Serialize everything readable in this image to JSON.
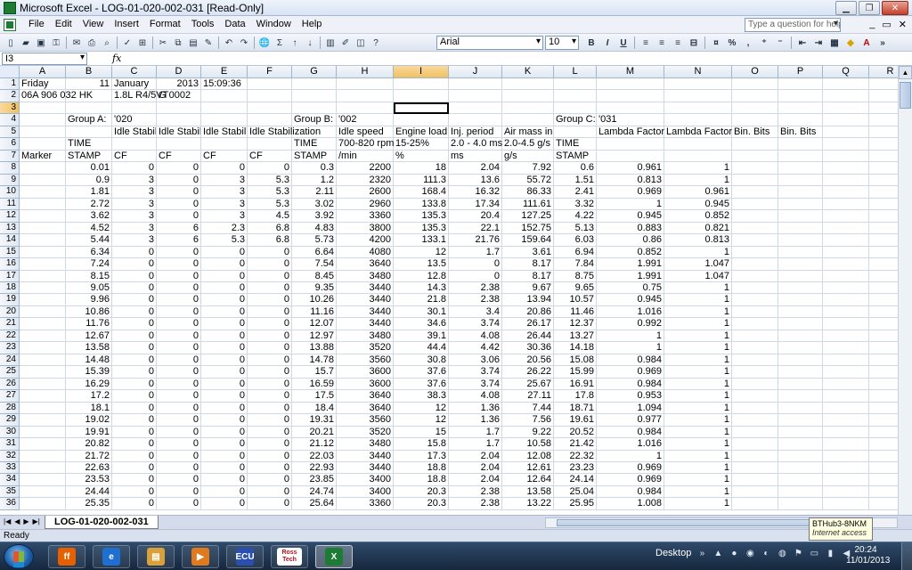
{
  "window": {
    "title": "Microsoft Excel - LOG-01-020-002-031  [Read-Only]"
  },
  "menu": {
    "items": [
      "File",
      "Edit",
      "View",
      "Insert",
      "Format",
      "Tools",
      "Data",
      "Window",
      "Help"
    ],
    "help_placeholder": "Type a question for help"
  },
  "toolbar": {
    "font": "Arial",
    "size": "10",
    "bold": "B",
    "italic": "I",
    "underline": "U",
    "percent": "%",
    "comma": ","
  },
  "formula_bar": {
    "name_box": "I3",
    "fx": "fx"
  },
  "columns": [
    "A",
    "B",
    "C",
    "D",
    "E",
    "F",
    "G",
    "H",
    "I",
    "J",
    "K",
    "L",
    "M",
    "N",
    "O",
    "P",
    "Q",
    "R"
  ],
  "active_column": "I",
  "active_row": 3,
  "rows": [
    {
      "n": 1,
      "cells": {
        "A": "Friday",
        "B": "11",
        "C": "January",
        "D": "2013",
        "E": "15:09:36"
      }
    },
    {
      "n": 2,
      "cells": {
        "A": "06A 906 032 HK",
        "C": "1.8L R4/5VT",
        "D": "G    0002"
      }
    },
    {
      "n": 3,
      "cells": {}
    },
    {
      "n": 4,
      "cells": {
        "B": "Group A:",
        "C": "'020",
        "G": "Group B:",
        "H": "'002",
        "L": "Group C:",
        "M": "'031"
      }
    },
    {
      "n": 5,
      "cells": {
        "C": "Idle Stabili",
        "D": "Idle Stabili",
        "E": "Idle Stabili",
        "F": "Idle Stabilization",
        "H": "Idle speed",
        "I": "Engine load",
        "J": "Inj. period",
        "K": "Air mass in",
        "M": "Lambda Factor",
        "N": "Lambda Factor",
        "O": "Bin. Bits",
        "P": "Bin. Bits"
      }
    },
    {
      "n": 6,
      "cells": {
        "B": "TIME",
        "G": "TIME",
        "H": "700-820 rpm",
        "I": "15-25%",
        "J": "2.0 - 4.0 ms",
        "K": "2.0-4.5 g/s",
        "L": "TIME"
      }
    },
    {
      "n": 7,
      "cells": {
        "A": "Marker",
        "B": "STAMP",
        "C": "CF",
        "D": "CF",
        "E": "CF",
        "F": "CF",
        "G": "STAMP",
        "H": " /min",
        "I": "%",
        "J": "ms",
        "K": "g/s",
        "L": "STAMP"
      }
    },
    {
      "n": 8,
      "cells": {
        "B": "0.01",
        "C": "0",
        "D": "0",
        "E": "0",
        "F": "0",
        "G": "0.3",
        "H": "2200",
        "I": "18",
        "J": "2.04",
        "K": "7.92",
        "L": "0.6",
        "M": "0.961",
        "N": "1"
      }
    },
    {
      "n": 9,
      "cells": {
        "B": "0.9",
        "C": "3",
        "D": "0",
        "E": "3",
        "F": "5.3",
        "G": "1.2",
        "H": "2320",
        "I": "111.3",
        "J": "13.6",
        "K": "55.72",
        "L": "1.51",
        "M": "0.813",
        "N": "1"
      }
    },
    {
      "n": 10,
      "cells": {
        "B": "1.81",
        "C": "3",
        "D": "0",
        "E": "3",
        "F": "5.3",
        "G": "2.11",
        "H": "2600",
        "I": "168.4",
        "J": "16.32",
        "K": "86.33",
        "L": "2.41",
        "M": "0.969",
        "N": "0.961"
      }
    },
    {
      "n": 11,
      "cells": {
        "B": "2.72",
        "C": "3",
        "D": "0",
        "E": "3",
        "F": "5.3",
        "G": "3.02",
        "H": "2960",
        "I": "133.8",
        "J": "17.34",
        "K": "111.61",
        "L": "3.32",
        "M": "1",
        "N": "0.945"
      }
    },
    {
      "n": 12,
      "cells": {
        "B": "3.62",
        "C": "3",
        "D": "0",
        "E": "3",
        "F": "4.5",
        "G": "3.92",
        "H": "3360",
        "I": "135.3",
        "J": "20.4",
        "K": "127.25",
        "L": "4.22",
        "M": "0.945",
        "N": "0.852"
      }
    },
    {
      "n": 13,
      "cells": {
        "B": "4.52",
        "C": "3",
        "D": "6",
        "E": "2.3",
        "F": "6.8",
        "G": "4.83",
        "H": "3800",
        "I": "135.3",
        "J": "22.1",
        "K": "152.75",
        "L": "5.13",
        "M": "0.883",
        "N": "0.821"
      }
    },
    {
      "n": 14,
      "cells": {
        "B": "5.44",
        "C": "3",
        "D": "6",
        "E": "5.3",
        "F": "6.8",
        "G": "5.73",
        "H": "4200",
        "I": "133.1",
        "J": "21.76",
        "K": "159.64",
        "L": "6.03",
        "M": "0.86",
        "N": "0.813"
      }
    },
    {
      "n": 15,
      "cells": {
        "B": "6.34",
        "C": "0",
        "D": "0",
        "E": "0",
        "F": "0",
        "G": "6.64",
        "H": "4080",
        "I": "12",
        "J": "1.7",
        "K": "3.61",
        "L": "6.94",
        "M": "0.852",
        "N": "1"
      }
    },
    {
      "n": 16,
      "cells": {
        "B": "7.24",
        "C": "0",
        "D": "0",
        "E": "0",
        "F": "0",
        "G": "7.54",
        "H": "3640",
        "I": "13.5",
        "J": "0",
        "K": "8.17",
        "L": "7.84",
        "M": "1.991",
        "N": "1.047"
      }
    },
    {
      "n": 17,
      "cells": {
        "B": "8.15",
        "C": "0",
        "D": "0",
        "E": "0",
        "F": "0",
        "G": "8.45",
        "H": "3480",
        "I": "12.8",
        "J": "0",
        "K": "8.17",
        "L": "8.75",
        "M": "1.991",
        "N": "1.047"
      }
    },
    {
      "n": 18,
      "cells": {
        "B": "9.05",
        "C": "0",
        "D": "0",
        "E": "0",
        "F": "0",
        "G": "9.35",
        "H": "3440",
        "I": "14.3",
        "J": "2.38",
        "K": "9.67",
        "L": "9.65",
        "M": "0.75",
        "N": "1"
      }
    },
    {
      "n": 19,
      "cells": {
        "B": "9.96",
        "C": "0",
        "D": "0",
        "E": "0",
        "F": "0",
        "G": "10.26",
        "H": "3440",
        "I": "21.8",
        "J": "2.38",
        "K": "13.94",
        "L": "10.57",
        "M": "0.945",
        "N": "1"
      }
    },
    {
      "n": 20,
      "cells": {
        "B": "10.86",
        "C": "0",
        "D": "0",
        "E": "0",
        "F": "0",
        "G": "11.16",
        "H": "3440",
        "I": "30.1",
        "J": "3.4",
        "K": "20.86",
        "L": "11.46",
        "M": "1.016",
        "N": "1"
      }
    },
    {
      "n": 21,
      "cells": {
        "B": "11.76",
        "C": "0",
        "D": "0",
        "E": "0",
        "F": "0",
        "G": "12.07",
        "H": "3440",
        "I": "34.6",
        "J": "3.74",
        "K": "26.17",
        "L": "12.37",
        "M": "0.992",
        "N": "1"
      }
    },
    {
      "n": 22,
      "cells": {
        "B": "12.67",
        "C": "0",
        "D": "0",
        "E": "0",
        "F": "0",
        "G": "12.97",
        "H": "3480",
        "I": "39.1",
        "J": "4.08",
        "K": "26.44",
        "L": "13.27",
        "M": "1",
        "N": "1"
      }
    },
    {
      "n": 23,
      "cells": {
        "B": "13.58",
        "C": "0",
        "D": "0",
        "E": "0",
        "F": "0",
        "G": "13.88",
        "H": "3520",
        "I": "44.4",
        "J": "4.42",
        "K": "30.36",
        "L": "14.18",
        "M": "1",
        "N": "1"
      }
    },
    {
      "n": 24,
      "cells": {
        "B": "14.48",
        "C": "0",
        "D": "0",
        "E": "0",
        "F": "0",
        "G": "14.78",
        "H": "3560",
        "I": "30.8",
        "J": "3.06",
        "K": "20.56",
        "L": "15.08",
        "M": "0.984",
        "N": "1"
      }
    },
    {
      "n": 25,
      "cells": {
        "B": "15.39",
        "C": "0",
        "D": "0",
        "E": "0",
        "F": "0",
        "G": "15.7",
        "H": "3600",
        "I": "37.6",
        "J": "3.74",
        "K": "26.22",
        "L": "15.99",
        "M": "0.969",
        "N": "1"
      }
    },
    {
      "n": 26,
      "cells": {
        "B": "16.29",
        "C": "0",
        "D": "0",
        "E": "0",
        "F": "0",
        "G": "16.59",
        "H": "3600",
        "I": "37.6",
        "J": "3.74",
        "K": "25.67",
        "L": "16.91",
        "M": "0.984",
        "N": "1"
      }
    },
    {
      "n": 27,
      "cells": {
        "B": "17.2",
        "C": "0",
        "D": "0",
        "E": "0",
        "F": "0",
        "G": "17.5",
        "H": "3640",
        "I": "38.3",
        "J": "4.08",
        "K": "27.11",
        "L": "17.8",
        "M": "0.953",
        "N": "1"
      }
    },
    {
      "n": 28,
      "cells": {
        "B": "18.1",
        "C": "0",
        "D": "0",
        "E": "0",
        "F": "0",
        "G": "18.4",
        "H": "3640",
        "I": "12",
        "J": "1.36",
        "K": "7.44",
        "L": "18.71",
        "M": "1.094",
        "N": "1"
      }
    },
    {
      "n": 29,
      "cells": {
        "B": "19.02",
        "C": "0",
        "D": "0",
        "E": "0",
        "F": "0",
        "G": "19.31",
        "H": "3560",
        "I": "12",
        "J": "1.36",
        "K": "7.56",
        "L": "19.61",
        "M": "0.977",
        "N": "1"
      }
    },
    {
      "n": 30,
      "cells": {
        "B": "19.91",
        "C": "0",
        "D": "0",
        "E": "0",
        "F": "0",
        "G": "20.21",
        "H": "3520",
        "I": "15",
        "J": "1.7",
        "K": "9.22",
        "L": "20.52",
        "M": "0.984",
        "N": "1"
      }
    },
    {
      "n": 31,
      "cells": {
        "B": "20.82",
        "C": "0",
        "D": "0",
        "E": "0",
        "F": "0",
        "G": "21.12",
        "H": "3480",
        "I": "15.8",
        "J": "1.7",
        "K": "10.58",
        "L": "21.42",
        "M": "1.016",
        "N": "1"
      }
    },
    {
      "n": 32,
      "cells": {
        "B": "21.72",
        "C": "0",
        "D": "0",
        "E": "0",
        "F": "0",
        "G": "22.03",
        "H": "3440",
        "I": "17.3",
        "J": "2.04",
        "K": "12.08",
        "L": "22.32",
        "M": "1",
        "N": "1"
      }
    },
    {
      "n": 33,
      "cells": {
        "B": "22.63",
        "C": "0",
        "D": "0",
        "E": "0",
        "F": "0",
        "G": "22.93",
        "H": "3440",
        "I": "18.8",
        "J": "2.04",
        "K": "12.61",
        "L": "23.23",
        "M": "0.969",
        "N": "1"
      }
    },
    {
      "n": 34,
      "cells": {
        "B": "23.53",
        "C": "0",
        "D": "0",
        "E": "0",
        "F": "0",
        "G": "23.85",
        "H": "3400",
        "I": "18.8",
        "J": "2.04",
        "K": "12.64",
        "L": "24.14",
        "M": "0.969",
        "N": "1"
      }
    },
    {
      "n": 35,
      "cells": {
        "B": "24.44",
        "C": "0",
        "D": "0",
        "E": "0",
        "F": "0",
        "G": "24.74",
        "H": "3400",
        "I": "20.3",
        "J": "2.38",
        "K": "13.58",
        "L": "25.04",
        "M": "0.984",
        "N": "1"
      }
    },
    {
      "n": 36,
      "cells": {
        "B": "25.35",
        "C": "0",
        "D": "0",
        "E": "0",
        "F": "0",
        "G": "25.64",
        "H": "3360",
        "I": "20.3",
        "J": "2.38",
        "K": "13.22",
        "L": "25.95",
        "M": "1.008",
        "N": "1"
      }
    }
  ],
  "sheet_tab": "LOG-01-020-002-031",
  "status": "Ready",
  "tooltip": {
    "title": "BTHub3-8NKM",
    "subtitle": "Internet access"
  },
  "taskbar": {
    "apps": [
      {
        "name": "firefox",
        "glyph": "ff",
        "color": "#e66000"
      },
      {
        "name": "internet-explorer",
        "glyph": "e",
        "color": "#1f6fd1"
      },
      {
        "name": "file-explorer",
        "glyph": "▤",
        "color": "#d8a13a"
      },
      {
        "name": "media-player",
        "glyph": "▶",
        "color": "#e07a1f"
      },
      {
        "name": "ecu",
        "glyph": "ECU",
        "color": "#2b4fb0"
      },
      {
        "name": "ross-tech",
        "label": "Ross Tech",
        "color": "#ffffff"
      },
      {
        "name": "excel",
        "glyph": "X",
        "color": "#1e7b34"
      }
    ],
    "desktop_label": "Desktop",
    "time": "20:24",
    "date": "11/01/2013"
  }
}
